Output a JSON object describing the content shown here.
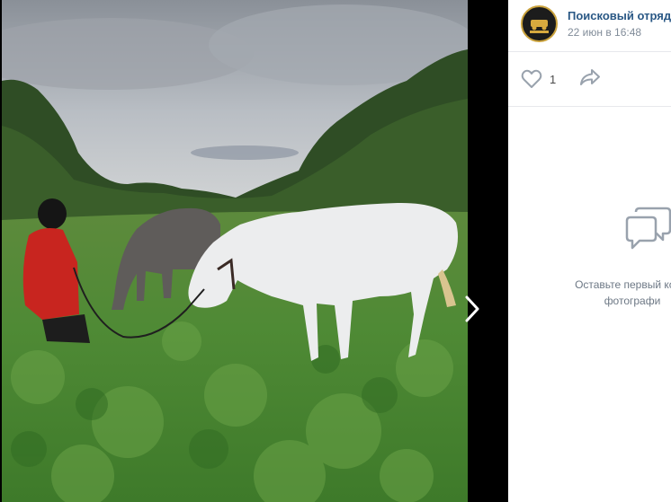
{
  "post": {
    "author": "Поисковый отряд \"",
    "date": "22 июн в 16:48"
  },
  "actions": {
    "like_count": "1"
  },
  "comments": {
    "empty_line1": "Оставьте первый комм",
    "empty_line2": "фотографи"
  },
  "icons": {
    "like": "heart-icon",
    "share": "share-arrow-icon",
    "next": "chevron-right-icon",
    "comment": "comment-bubbles-icon"
  },
  "colors": {
    "link": "#2a5885",
    "muted": "#818c99",
    "icon": "#99a2ad"
  }
}
